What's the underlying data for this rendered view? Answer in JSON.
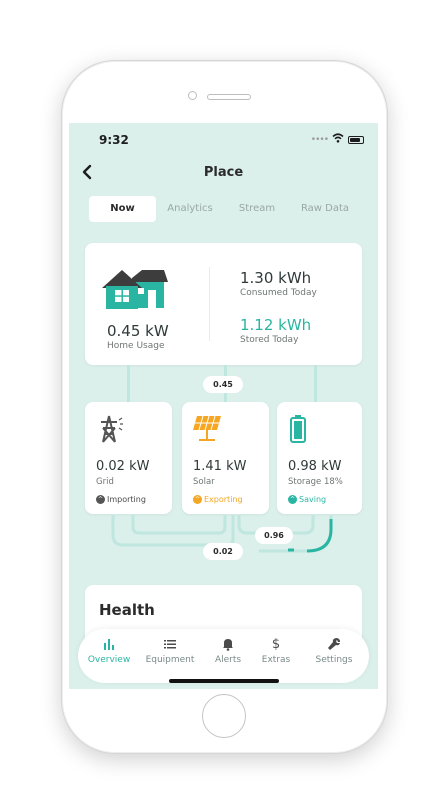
{
  "status_bar": {
    "time": "9:32"
  },
  "header": {
    "title": "Place"
  },
  "tabs": [
    {
      "label": "Now",
      "active": true
    },
    {
      "label": "Analytics",
      "active": false
    },
    {
      "label": "Stream",
      "active": false
    },
    {
      "label": "Raw Data",
      "active": false
    }
  ],
  "summary": {
    "home_usage_value": "0.45 kW",
    "home_usage_label": "Home Usage",
    "consumed_value": "1.30 kWh",
    "consumed_label": "Consumed Today",
    "stored_value": "1.12 kWh",
    "stored_label": "Stored Today"
  },
  "flows": {
    "top": "0.45",
    "right": "0.96",
    "bottom": "0.02"
  },
  "nodes": {
    "grid": {
      "value": "0.02 kW",
      "label": "Grid",
      "status": "Importing"
    },
    "solar": {
      "value": "1.41 kW",
      "label": "Solar",
      "status": "Exporting"
    },
    "storage": {
      "value": "0.98 kW",
      "label": "Storage 18%",
      "status": "Saving"
    }
  },
  "health": {
    "title": "Health"
  },
  "nav": [
    {
      "label": "Overview",
      "icon": "bar-chart-icon",
      "active": true
    },
    {
      "label": "Equipment",
      "icon": "list-icon",
      "active": false
    },
    {
      "label": "Alerts",
      "icon": "bell-icon",
      "active": false
    },
    {
      "label": "Extras",
      "icon": "dollar-icon",
      "active": false
    },
    {
      "label": "Settings",
      "icon": "wrench-icon",
      "active": false
    }
  ],
  "colors": {
    "accent": "#2ab5a3",
    "screen_bg": "#dbefeb",
    "solar": "#f5a623",
    "grid": "#555555",
    "storage": "#2ab5a3"
  }
}
